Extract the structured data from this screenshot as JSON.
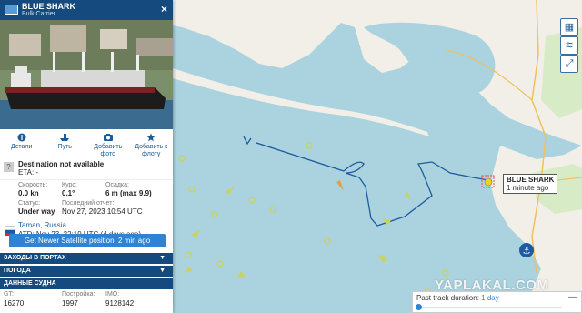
{
  "vessel": {
    "name": "BLUE SHARK",
    "type": "Bulk Carrier"
  },
  "actions": [
    {
      "label": "Детали",
      "icon": "info-icon"
    },
    {
      "label": "Путь",
      "icon": "route-icon"
    },
    {
      "label": "Добавить фото",
      "icon": "camera-icon"
    },
    {
      "label": "Добавить к флоту",
      "icon": "star-icon"
    }
  ],
  "destination": {
    "status": "Destination not available",
    "eta": "ETA: -"
  },
  "nav": {
    "speed_label": "Скорость:",
    "speed": "0.0 kn",
    "course_label": "Курс:",
    "course": "0.1°",
    "draught_label": "Осадка:",
    "draught": "6 m (max 9.9)",
    "status_label": "Статус:",
    "status": "Under way",
    "report_label": "Последний отчет:",
    "report": "Nov 27, 2023 10:54 UTC"
  },
  "last_port": {
    "name": "Taman, Russia",
    "atd": "ATD: Nov 23, 22:19 UTC (4 days ago)"
  },
  "get_button": "Get Newer Satellite position: 2 min ago",
  "sections": [
    "ЗАХОДЫ В ПОРТАХ",
    "ПОГОДА",
    "ДАННЫЕ СУДНА"
  ],
  "specs": {
    "gt_label": "GT:",
    "gt": "16270",
    "built_label": "Постройка:",
    "built": "1997",
    "imo_label": "IMO:",
    "imo": "9128142"
  },
  "map_tooltip": {
    "name": "BLUE SHARK",
    "time": "1 minute ago"
  },
  "watermark": "YAPLAKAL.COM",
  "track": {
    "label": "Past track duration:",
    "value": "1 day"
  },
  "colors": {
    "header": "#144a7e",
    "accent": "#2e83d4",
    "sea": "#aad3df",
    "land": "#f2efe9",
    "track": "#1f5a9e"
  }
}
